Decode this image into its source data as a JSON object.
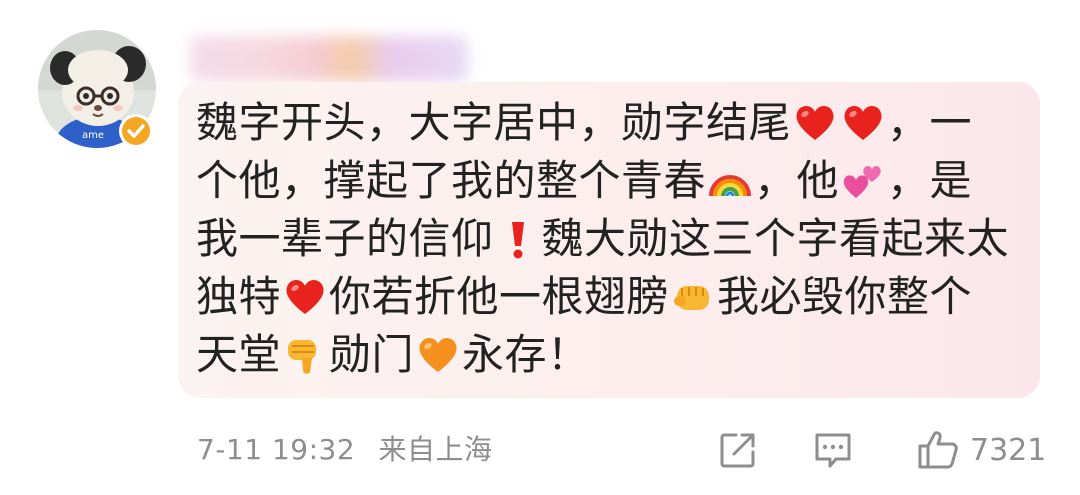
{
  "post": {
    "comment_lines": [
      [
        "魏字开头，大字居中，勋字结尾",
        "red-heart-emoji",
        "red-heart-emoji",
        "，一"
      ],
      [
        "个他，撑起了我的整个青春",
        "rainbow-emoji",
        "，他",
        "two-hearts-emoji",
        "，是"
      ],
      [
        "我一辈子的信仰",
        "exclamation-emoji",
        "魏大勋这三个字看起来太"
      ],
      [
        "独特",
        "red-heart-emoji",
        "你若折他一根翅膀",
        "fist-emoji",
        "我必毁你整个"
      ],
      [
        "天堂",
        "thumbs-down-emoji",
        "勋门",
        "orange-heart-emoji",
        "永存！"
      ]
    ],
    "timestamp": "7-11 19:32",
    "location": "来自上海",
    "like_count": "7321"
  },
  "icons": {
    "verified": "verified-badge-icon",
    "share": "share-icon",
    "comment": "comment-icon",
    "like": "like-icon"
  },
  "colors": {
    "bubble_background": "#fdeeee",
    "text": "#222222",
    "meta_text": "#8e8e8e",
    "verified_badge": "#f5a623"
  }
}
